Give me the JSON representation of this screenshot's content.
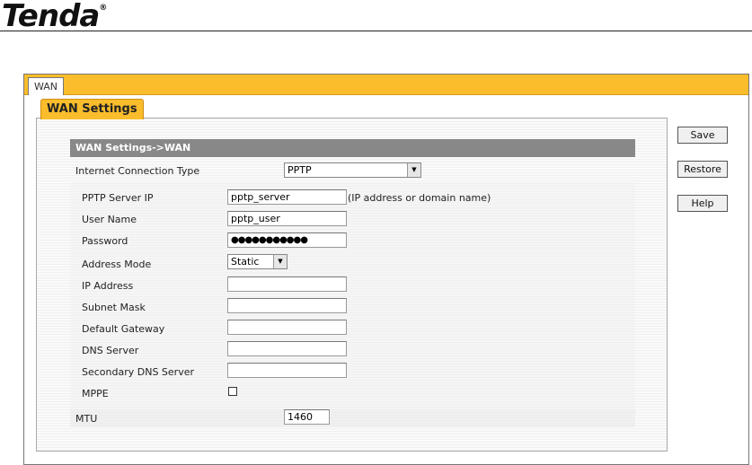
{
  "brand": {
    "logo_text": "Tenda",
    "trademark": "®"
  },
  "tabs": {
    "wan": "WAN",
    "wan_settings": "WAN Settings"
  },
  "section": {
    "title": "WAN Settings->WAN"
  },
  "connection_type": {
    "label": "Internet Connection Type",
    "value": "PPTP"
  },
  "fields": {
    "pptp_server_ip": {
      "label": "PPTP Server IP",
      "value": "pptp_server",
      "hint": "(IP address or domain name)"
    },
    "user_name": {
      "label": "User Name",
      "value": "pptp_user"
    },
    "password": {
      "label": "Password",
      "value": "●●●●●●●●●●●"
    },
    "address_mode": {
      "label": "Address Mode",
      "value": "Static"
    },
    "ip_address": {
      "label": "IP Address",
      "value": ""
    },
    "subnet_mask": {
      "label": "Subnet Mask",
      "value": ""
    },
    "default_gateway": {
      "label": "Default Gateway",
      "value": ""
    },
    "dns_server": {
      "label": "DNS Server",
      "value": ""
    },
    "secondary_dns_server": {
      "label": "Secondary DNS Server",
      "value": ""
    },
    "mppe": {
      "label": "MPPE",
      "checked": false
    },
    "mtu": {
      "label": "MTU",
      "value": "1460"
    }
  },
  "buttons": {
    "save": "Save",
    "restore": "Restore",
    "help": "Help"
  },
  "colors": {
    "accent": "#fbbd2b",
    "section_header": "#888888"
  },
  "icons": {
    "dropdown": "triangle-down-icon"
  }
}
